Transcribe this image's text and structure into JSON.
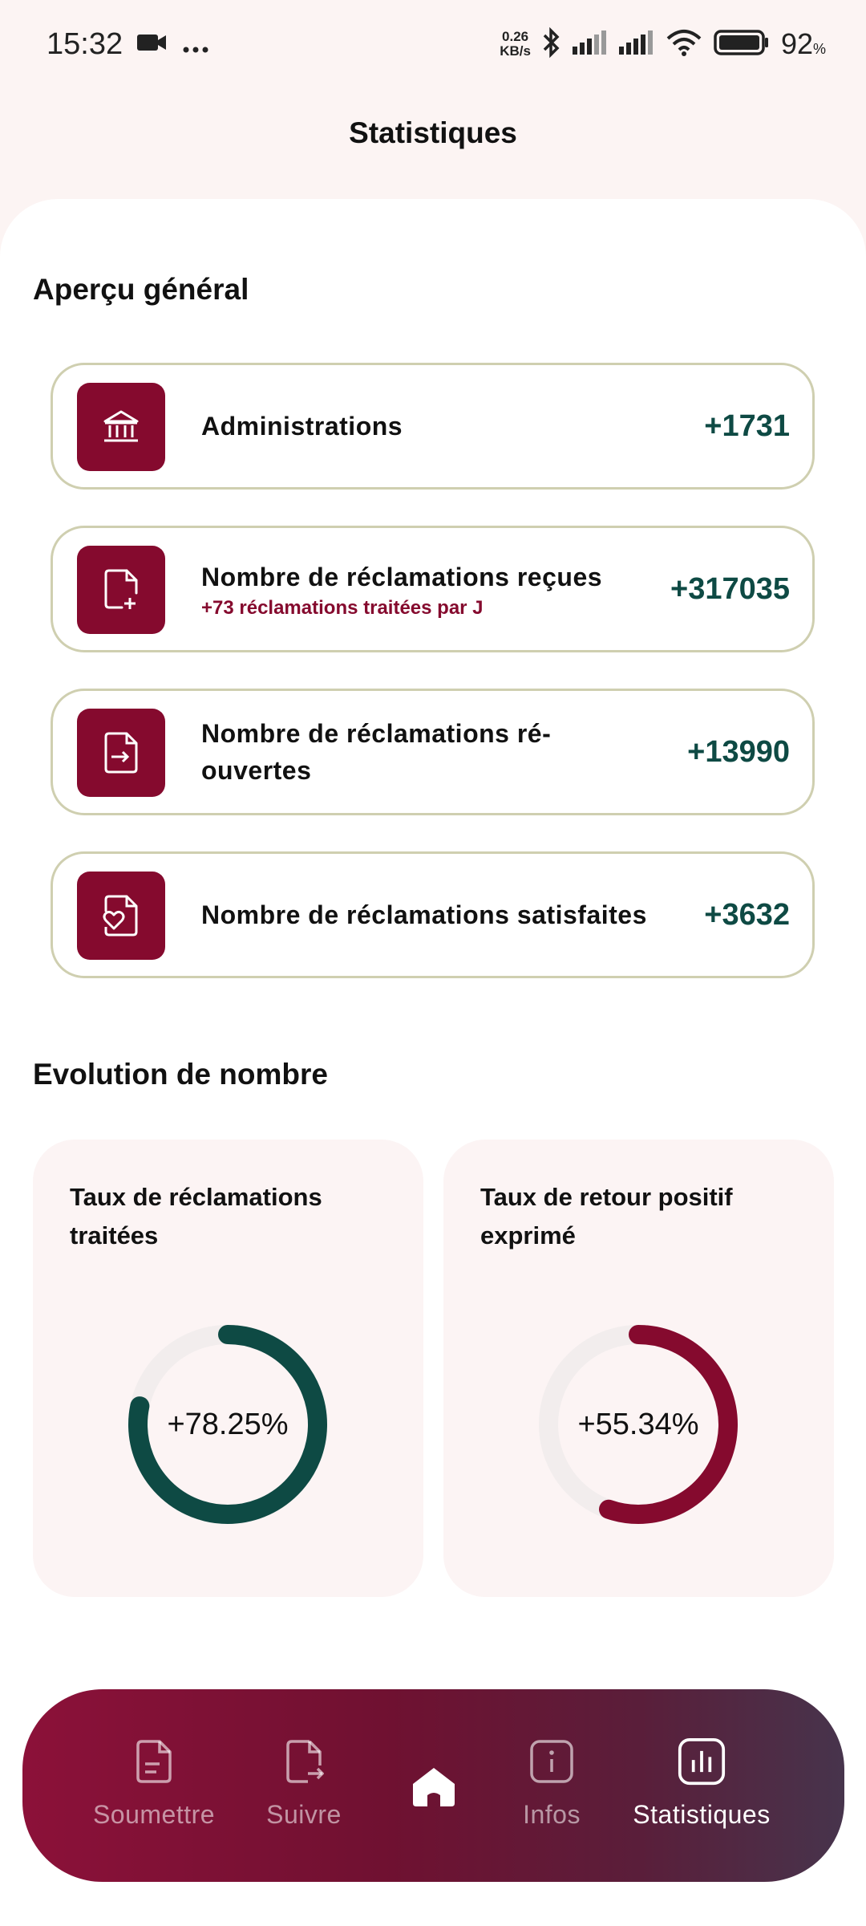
{
  "status_bar": {
    "time": "15:32",
    "net_speed_value": "0.26",
    "net_speed_unit": "KB/s",
    "battery_percent": "92",
    "battery_unit": "%"
  },
  "header": {
    "title": "Statistiques"
  },
  "overview": {
    "title": "Aperçu général",
    "cards": [
      {
        "label": "Administrations",
        "sub": "",
        "value": "+1731",
        "icon": "bank-icon"
      },
      {
        "label": "Nombre de réclamations reçues",
        "sub": "+73 réclamations traitées par J",
        "value": "+317035",
        "icon": "file-add-icon"
      },
      {
        "label": "Nombre de réclamations ré-ouvertes",
        "sub": "",
        "value": "+13990",
        "icon": "file-import-icon"
      },
      {
        "label": "Nombre de réclamations satisfaites",
        "sub": "",
        "value": "+3632",
        "icon": "file-heart-icon"
      }
    ]
  },
  "evolution": {
    "title": "Evolution de nombre",
    "cards": [
      {
        "title": "Taux de réclamations traitées",
        "value_label": "+78.25%",
        "percent": 78.25,
        "color": "#0e4a44"
      },
      {
        "title": "Taux de retour positif exprimé",
        "value_label": "+55.34%",
        "percent": 55.34,
        "color": "#850a2e"
      }
    ]
  },
  "nav": {
    "items": [
      {
        "label": "Soumettre",
        "icon": "file-text-icon"
      },
      {
        "label": "Suivre",
        "icon": "file-export-icon"
      },
      {
        "label": "",
        "icon": "home-icon"
      },
      {
        "label": "Infos",
        "icon": "info-icon"
      },
      {
        "label": "Statistiques",
        "icon": "bar-chart-icon"
      }
    ]
  },
  "colors": {
    "primary": "#850a2e",
    "accent": "#0e4a44",
    "border": "#cfcfb0"
  }
}
